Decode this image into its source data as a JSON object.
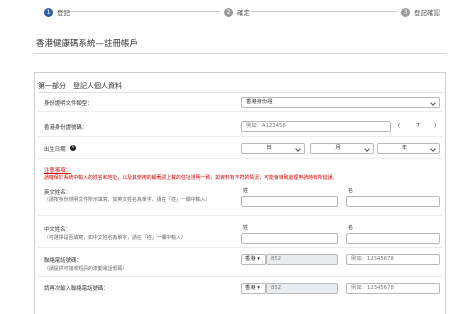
{
  "stepper": {
    "steps": [
      {
        "num": "1",
        "label": "登記",
        "color": "#2f5fa7"
      },
      {
        "num": "2",
        "label": "確定",
        "color": "#9a9a9a"
      },
      {
        "num": "3",
        "label": "登記確認",
        "color": "#9a9a9a"
      }
    ]
  },
  "page": {
    "title": "香港健康碼系統—註冊帳戶"
  },
  "section": {
    "heading": "第一部分　登記人個人資料"
  },
  "form": {
    "id_type": {
      "label": "身份證明文件類型：",
      "value": "香港身份證"
    },
    "id_number": {
      "label": "香港身份證號碼：",
      "placeholder": "例如：A123456",
      "check_open": "(",
      "check_value": "7",
      "check_close": ")"
    },
    "dob": {
      "label": "出生日期",
      "info_icon": "i",
      "day": "日",
      "month": "月",
      "year": "年"
    },
    "notice": {
      "title": "注意事項：",
      "text": "請確保於系統中輸入的姓名和地址，以及其使用的顯著詞上載的住址證明一致，如資料有不符的情況，可能會導致處理申請時有所延誤。"
    },
    "english_name": {
      "label": "英文姓名：",
      "hint": "（請按身份證明文件所示填寫，如英文姓名為單字，請在「姓」一欄中輸入）",
      "surname_label": "姓",
      "given_label": "名"
    },
    "chinese_name": {
      "label": "中文姓名：",
      "hint": "（可選擇是否填寫，如中文姓名為單字，請在「姓」一欄中輸入）",
      "surname_label": "姓",
      "given_label": "名"
    },
    "phone": {
      "label": "聯絡電話號碼：",
      "hint": "（請提供可接收短訊的流動電話號碼）",
      "region": "香港",
      "code": "852",
      "placeholder": "例如：12345678"
    },
    "phone_confirm": {
      "label": "請再次輸入聯絡電話號碼：",
      "region": "香港",
      "code": "852",
      "placeholder": "例如：12345678"
    }
  }
}
